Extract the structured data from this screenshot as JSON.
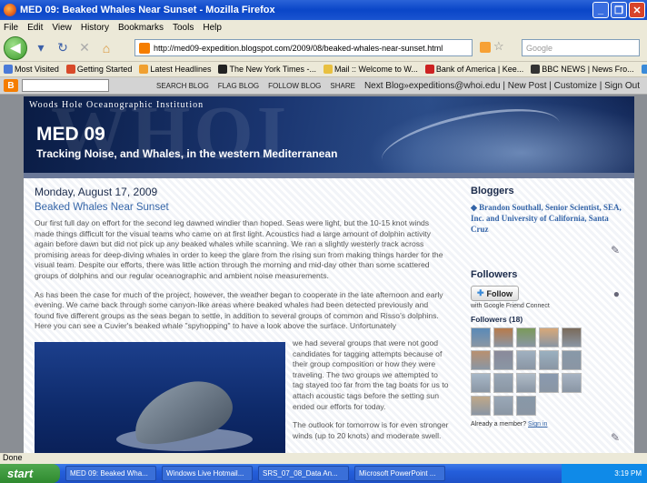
{
  "window": {
    "title": "MED 09: Beaked Whales Near Sunset - Mozilla Firefox"
  },
  "menu": [
    "File",
    "Edit",
    "View",
    "History",
    "Bookmarks",
    "Tools",
    "Help"
  ],
  "toolbar": {
    "url": "http://med09-expedition.blogspot.com/2009/08/beaked-whales-near-sunset.html",
    "search_placeholder": "Google"
  },
  "bookmarks": [
    {
      "label": "Most Visited",
      "color": "#4a7ad8"
    },
    {
      "label": "Getting Started",
      "color": "#d84a2a"
    },
    {
      "label": "Latest Headlines",
      "color": "#f0a030"
    },
    {
      "label": "The New York Times -...",
      "color": "#222222"
    },
    {
      "label": "Mail :: Welcome to W...",
      "color": "#e8c040"
    },
    {
      "label": "Bank of America | Kee...",
      "color": "#cc2222"
    },
    {
      "label": "BBC NEWS | News Fro...",
      "color": "#333333"
    },
    {
      "label": "Google Scholar",
      "color": "#3a8ad8"
    }
  ],
  "blogbar": {
    "links": [
      "SEARCH BLOG",
      "FLAG BLOG",
      "FOLLOW BLOG",
      "SHARE"
    ],
    "next": "Next Blog»",
    "right": "expeditions@whoi.edu | New Post | Customize | Sign Out"
  },
  "header": {
    "institution": "Woods Hole Oceanographic Institution",
    "bg_text": "WHOI",
    "title": "MED 09",
    "subtitle": "Tracking Noise, and Whales, in the western Mediterranean"
  },
  "post": {
    "date": "Monday, August 17, 2009",
    "title": "Beaked Whales Near Sunset",
    "p1": "Our first full day on effort for the second leg dawned windier than hoped. Seas were light, but the 10-15 knot winds made things difficult for the visual teams who came on at first light. Acoustics had a large amount of dolphin activity again before dawn but did not pick up any beaked whales while scanning. We ran a slightly westerly track across promising areas for deep-diving whales in order to keep the glare from the rising sun from making things harder for the visual team. Despite our efforts, there was little action through the morning and mid-day other than some scattered groups of dolphins and our regular oceanographic and ambient noise measurements.",
    "p2": "As has been the case for much of the project, however, the weather began to cooperate in the late afternoon and early evening. We came back through some canyon-like areas where beaked whales had been detected previously and found five different groups as the seas began to settle, in addition to several groups of common and Risso's dolphins. Here you can see a Cuvier's beaked whale \"spyhopping\" to have a look above the surface. Unfortunately",
    "p3": "we had several groups that were not good candidates for tagging attempts because of their group composition or how they were traveling. The two groups we attempted to tag stayed too far from the tag boats for us to attach acoustic tags before the setting sun ended our efforts for today.",
    "p4": "The outlook for tomorrow is for even stronger winds (up to 20 knots) and moderate swell."
  },
  "sidebar": {
    "bloggers_heading": "Bloggers",
    "blogger": "Brandon Southall, Senior Scientist, SEA, Inc. and University of California, Santa Cruz",
    "followers_heading": "Followers",
    "follow_label": "Follow",
    "gfc": "with Google Friend Connect",
    "followers_count": "Followers (18)",
    "avatar_colors": [
      "#5a8ab8",
      "#b87a4a",
      "#7a9a5a",
      "#d8a878",
      "#7a6a5a",
      "#b89070",
      "#8a8a9a",
      "#a0b0c0",
      "#9ab0c0",
      "#8898a8",
      "#a8b8c8",
      "#9aa8b8",
      "#b0bcc8",
      "#8a9ab0",
      "#a8b4c4",
      "#c0a888",
      "#9aa8b8",
      "#8898a8"
    ],
    "member_text": "Already a member?",
    "sign_in": "Sign in"
  },
  "status": "Done",
  "taskbar": {
    "start": "start",
    "tasks": [
      "MED 09: Beaked Wha...",
      "Windows Live Hotmail...",
      "SRS_07_08_Data An...",
      "Microsoft PowerPoint ..."
    ],
    "time": "3:19 PM"
  }
}
